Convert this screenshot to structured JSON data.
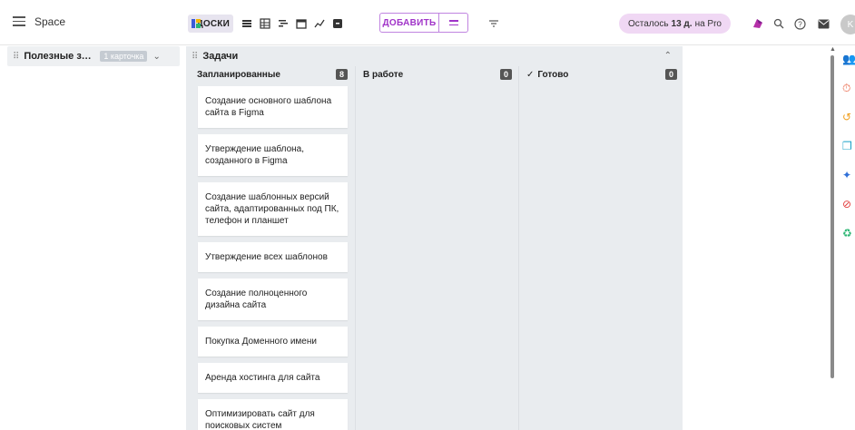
{
  "app": {
    "title": "Space"
  },
  "toolbar": {
    "views_label": "ДОСКИ",
    "add_label": "ДОБАВИТЬ"
  },
  "pro": {
    "prefix": "Осталось",
    "days": "13 д.",
    "suffix": "на Pro"
  },
  "avatar_initial": "K",
  "groups": [
    {
      "title": "Полезные заме...",
      "count_label": "1 карточка"
    }
  ],
  "board": {
    "title": "Задачи",
    "lanes": [
      {
        "title": "Запланированные",
        "count": "8",
        "cards": [
          "Создание основного шаблона сайта в Figma",
          "Утверждение шаблона, созданного в Figma",
          "Создание шаблонных версий сайта, адаптированных под ПК, телефон и планшет",
          "Утверждение всех шаблонов",
          "Создание полноценного дизайна сайта",
          "Покупка Доменного имени",
          "Аренда хостинга для сайта",
          "Оптимизировать сайт для поисковых систем"
        ]
      },
      {
        "title": "В работе",
        "count": "0",
        "cards": []
      },
      {
        "title": "Готово",
        "count": "0",
        "cards": []
      }
    ]
  },
  "colors": {
    "accent": "#a033c8",
    "pro_bg": "#f0d8f4",
    "board_bg": "#e9ecef"
  }
}
